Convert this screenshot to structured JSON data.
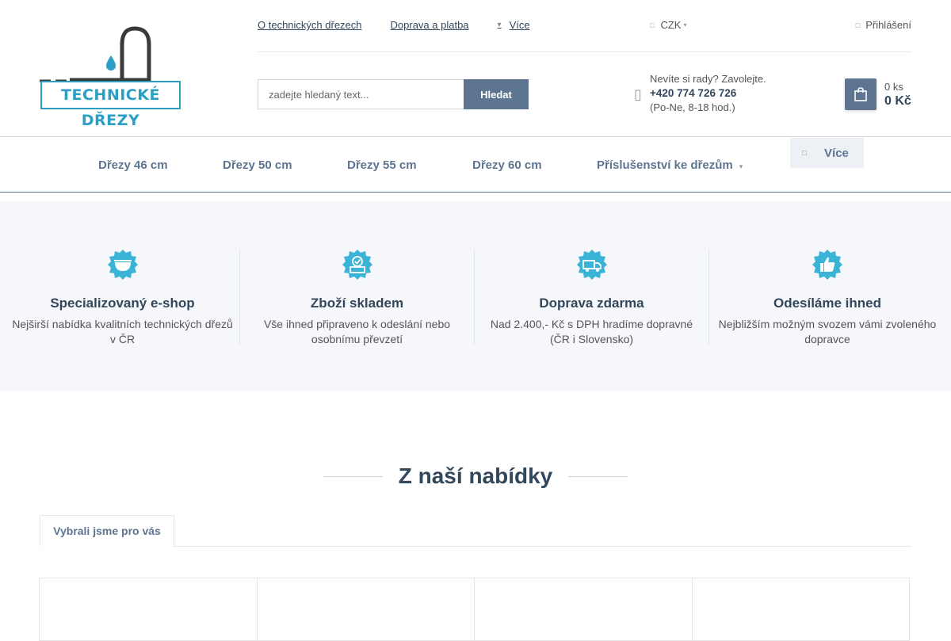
{
  "logo": {
    "text": "TECHNICKÉ DŘEZY",
    "color": "#2b9fc4"
  },
  "topnav": {
    "links": [
      "O technických dřezech",
      "Doprava a platba"
    ],
    "more_label": "Více"
  },
  "currency": {
    "label": "CZK"
  },
  "login": {
    "label": "Přihlášení"
  },
  "search": {
    "placeholder": "zadejte hledaný text...",
    "button_label": "Hledat"
  },
  "help": {
    "question": "Nevíte si rady? Zavolejte.",
    "phone": "+420 774 726 726",
    "hours": "(Po-Ne, 8-18 hod.)"
  },
  "cart": {
    "quantity": "0 ks",
    "price": "0 Kč"
  },
  "mainnav": {
    "items": [
      "Dřezy 46 cm",
      "Dřezy 50 cm",
      "Dřezy 55 cm",
      "Dřezy 60 cm",
      "Příslušenství ke dřezům"
    ],
    "more_label": "Více"
  },
  "benefits": [
    {
      "icon": "sink-badge-icon",
      "title": "Specializovaný e-shop",
      "desc": "Nejširší nabídka kvalitních technických dřezů v ČR"
    },
    {
      "icon": "stock-badge-icon",
      "title": "Zboží skladem",
      "desc": "Vše ihned připraveno k odeslání nebo osobnímu převzetí"
    },
    {
      "icon": "delivery-badge-icon",
      "title": "Doprava zdarma",
      "desc": "Nad 2.400,- Kč s DPH hradíme dopravné (ČR i Slovensko)"
    },
    {
      "icon": "thumbs-up-badge-icon",
      "title": "Odesíláme ihned",
      "desc": "Nejbližším možným svozem vámi zvoleného dopravce"
    }
  ],
  "section": {
    "title": "Z naší nabídky",
    "tab_label": "Vybrali jsme pro vás"
  },
  "colors": {
    "primary": "#5e7591",
    "badge": "#3bb3d6",
    "heading": "#33475b",
    "benefits_bg": "#f5f7fa"
  }
}
